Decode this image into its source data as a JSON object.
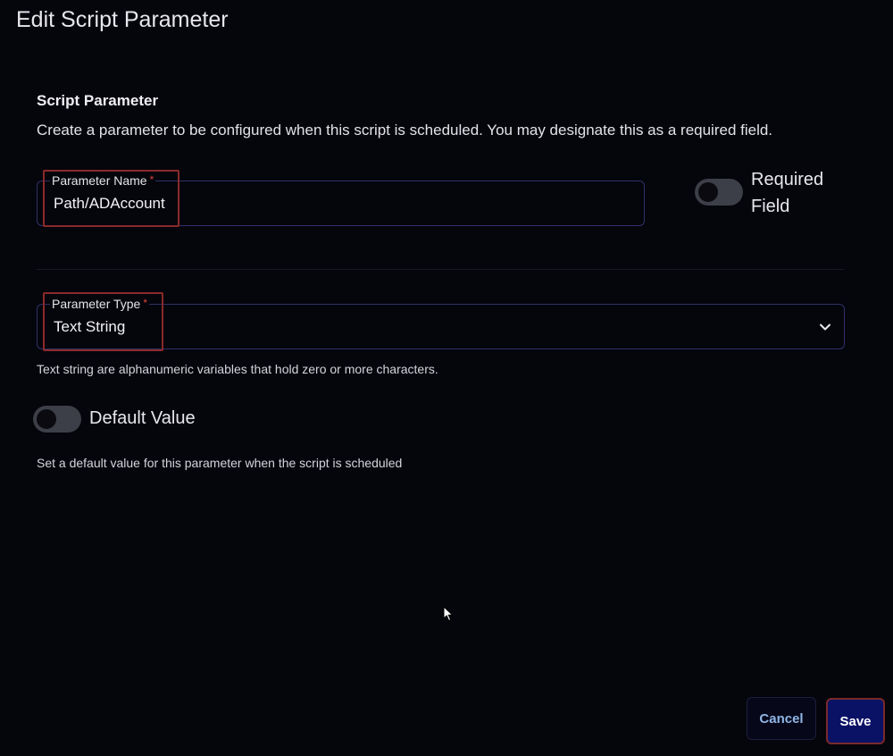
{
  "dialog": {
    "title": "Edit Script Parameter"
  },
  "section": {
    "heading": "Script Parameter",
    "description": "Create a parameter to be configured when this script is scheduled. You may designate this as a required field."
  },
  "parameter_name": {
    "label": "Parameter Name",
    "required_marker": "*",
    "value": "Path/ADAccount"
  },
  "required_field": {
    "label": "Required Field",
    "enabled": false
  },
  "parameter_type": {
    "label": "Parameter Type",
    "required_marker": "*",
    "value": "Text String",
    "helper": "Text string are alphanumeric variables that hold zero or more characters.",
    "icon": "chevron-down-icon"
  },
  "default_value": {
    "label": "Default Value",
    "enabled": false,
    "helper": "Set a default value for this parameter when the script is scheduled"
  },
  "footer": {
    "cancel_label": "Cancel",
    "save_label": "Save"
  },
  "colors": {
    "background": "#05050c",
    "field_border": "#2f3368",
    "highlight": "#8a2a2a",
    "save_bg": "#0a1266",
    "cancel_text": "#8fb6e6",
    "required_star": "#e0443a"
  }
}
